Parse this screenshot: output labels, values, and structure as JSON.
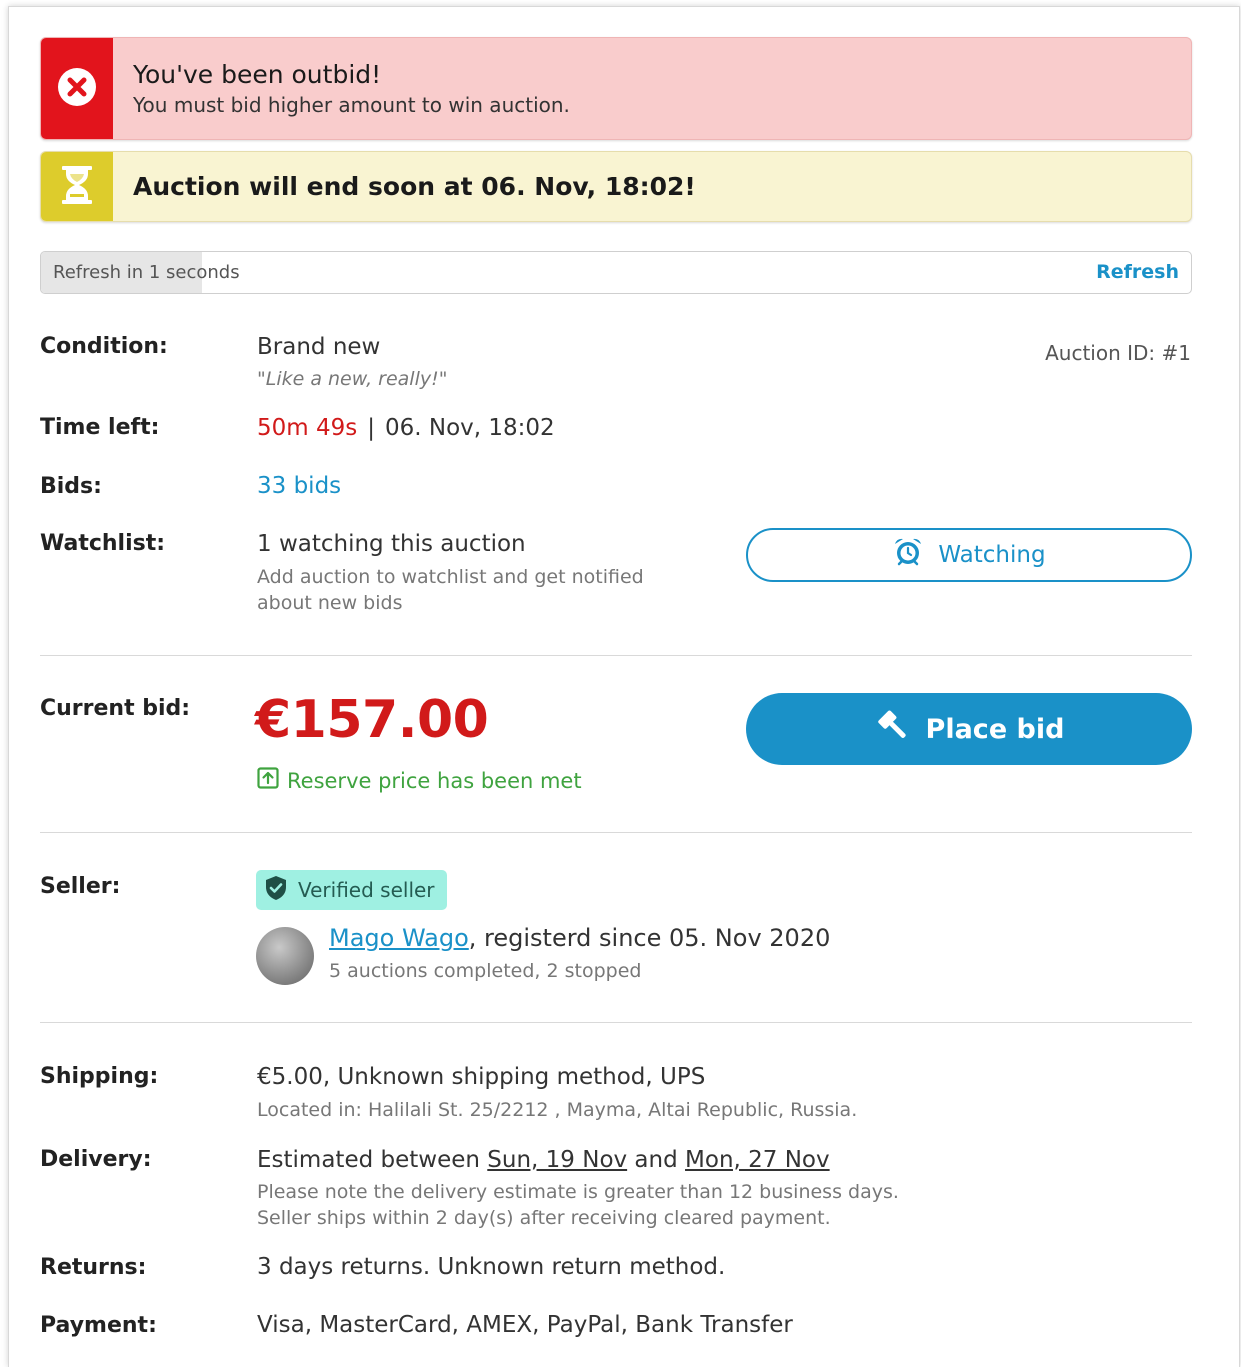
{
  "alerts": {
    "outbid": {
      "title": "You've been outbid!",
      "message": "You must bid higher amount to win auction."
    },
    "ending": {
      "title": "Auction will end soon at 06. Nov, 18:02!"
    }
  },
  "refresh": {
    "text": "Refresh in 1 seconds",
    "link": "Refresh",
    "progress": 0.14
  },
  "auction_id": "Auction ID: #1",
  "condition": {
    "label": "Condition:",
    "value": "Brand new",
    "note": "\"Like a new, really!\""
  },
  "time_left": {
    "label": "Time left:",
    "remaining": "50m 49s",
    "separator": "|",
    "end": "06. Nov, 18:02"
  },
  "bids": {
    "label": "Bids:",
    "value": "33 bids"
  },
  "watchlist": {
    "label": "Watchlist:",
    "value": "1 watching this auction",
    "hint_line1": "Add auction to watchlist and get notified",
    "hint_line2": "about new bids",
    "button": "Watching"
  },
  "current_bid": {
    "label": "Current bid:",
    "price": "€157.00",
    "reserve": "Reserve price has been met",
    "button": "Place bid"
  },
  "seller": {
    "label": "Seller:",
    "badge": "Verified seller",
    "name": "Mago Wago",
    "since": ", registerd since 05. Nov 2020",
    "stats": "5 auctions completed, 2 stopped"
  },
  "shipping": {
    "label": "Shipping:",
    "value": "€5.00, Unknown shipping method, UPS",
    "location": "Located in: Halilali St. 25/2212 , Mayma, Altai Republic, Russia."
  },
  "delivery": {
    "label": "Delivery:",
    "prefix": "Estimated between ",
    "date_from": "Sun, 19 Nov",
    "middle": " and ",
    "date_to": "Mon, 27 Nov",
    "note_line1": "Please note the delivery estimate is greater than 12 business days.",
    "note_line2": "Seller ships within 2 day(s) after receiving cleared payment."
  },
  "returns": {
    "label": "Returns:",
    "value": "3 days returns. Unknown return method."
  },
  "payment": {
    "label": "Payment:",
    "value": "Visa, MasterCard, AMEX, PayPal, Bank Transfer"
  },
  "colors": {
    "accent": "#1a91c8",
    "danger": "#d11a1a",
    "success": "#3fa33f",
    "warning": "#ddcc2c"
  },
  "icons": {
    "outbid": "close-circle-icon",
    "ending": "hourglass-icon",
    "watch": "alarm-clock-icon",
    "bid": "gavel-icon",
    "reserve": "arrow-up-square-icon",
    "verified": "shield-check-icon"
  }
}
